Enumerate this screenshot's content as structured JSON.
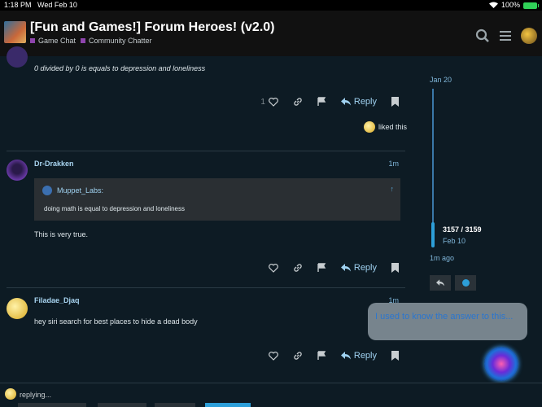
{
  "status_bar": {
    "time": "1:18 PM",
    "date": "Wed Feb 10",
    "battery": "100%"
  },
  "header": {
    "title": "[Fun and Games!] Forum Heroes! (v2.0)",
    "categories": [
      {
        "label": "Game Chat",
        "color": "#8e44ad"
      },
      {
        "label": "Community Chatter",
        "color": "#8e44ad"
      }
    ]
  },
  "posts": [
    {
      "body": "0 divided by 0 is equals to depression and loneliness",
      "like_count": "1",
      "reply_label": "Reply",
      "liked_text": "liked this"
    },
    {
      "author": "Dr-Drakken",
      "time": "1m",
      "quote_author": "Muppet_Labs:",
      "quote_body": "doing math is equal to depression and loneliness",
      "body": "This is very true.",
      "reply_label": "Reply"
    },
    {
      "author": "Filadae_Djaq",
      "time": "1m",
      "body": "hey siri search for best places to hide a dead body",
      "reply_label": "Reply"
    }
  ],
  "timeline": {
    "start_date": "Jan 20",
    "position": "3157 / 3159",
    "current_date": "Feb 10",
    "last_activity": "1m ago"
  },
  "siri": {
    "text": "I used to know the answer to this..."
  },
  "composer": {
    "replying_text": "replying..."
  },
  "colors": {
    "accent": "#2d9fd9",
    "link": "#9fd1f0",
    "background": "#0d1b24"
  }
}
